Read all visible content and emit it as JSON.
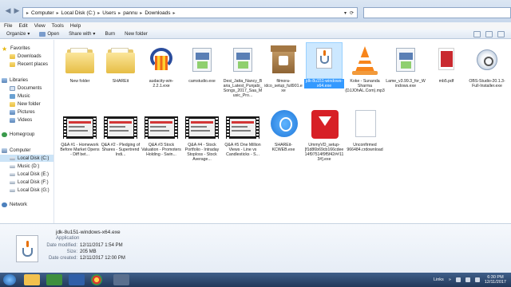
{
  "address": {
    "crumbs": [
      "Computer",
      "Local Disk (C:)",
      "Users",
      "pannu",
      "Downloads"
    ]
  },
  "menu": [
    "File",
    "Edit",
    "View",
    "Tools",
    "Help"
  ],
  "toolbar": {
    "organize": "Organize",
    "open": "Open",
    "share_with": "Share with",
    "burn": "Burn",
    "new_folder": "New folder"
  },
  "nav": {
    "favorites": "Favorites",
    "downloads": "Downloads",
    "recent": "Recent places",
    "libraries": "Libraries",
    "documents": "Documents",
    "music": "Music",
    "new_folder": "New folder",
    "pictures": "Pictures",
    "videos": "Videos",
    "homegroup": "Homegroup",
    "computer": "Computer",
    "local_c": "Local Disk (C:)",
    "music_d": "Music (D:)",
    "local_e": "Local Disk (E:)",
    "local_f": "Local Disk (F:)",
    "local_g": "Local Disk (G:)",
    "network": "Network"
  },
  "files": [
    {
      "label": "New folder",
      "icon": "folder-icon"
    },
    {
      "label": "SHAREit",
      "icon": "folder-icon"
    },
    {
      "label": "audacity-win-2.2.1.exe",
      "icon": "audacity-icon"
    },
    {
      "label": "camstudio.exe",
      "icon": "installer-icon"
    },
    {
      "label": "Desi_Jatta_Nancy_Baria_Latest_Punjabi_Songs_2017_Saa_Music_Pro...",
      "icon": "installer-icon"
    },
    {
      "label": "filmora-idco_setup_full901.exe",
      "icon": "filmora-box-icon"
    },
    {
      "label": "jdk-8u151-windows-x64.exe",
      "icon": "java-icon"
    },
    {
      "label": "Koke - Sunanda Sharma (DJJOhAL.Com).mp3",
      "icon": "vlc-cone-icon"
    },
    {
      "label": "Lame_v3.99.3_for_Windows.exe",
      "icon": "installer-icon"
    },
    {
      "label": "mb5.pdf",
      "icon": "pdf-icon"
    },
    {
      "label": "OBS-Studio-20.1.3-Full-Installer.exe",
      "icon": "obs-icon"
    },
    {
      "label": "Q&A #1 - Homework Before Market Opens - Diff bet...",
      "icon": "video-thumbnail-icon"
    },
    {
      "label": "Q&A #2 - Pledging of Shares - Supertrend Indi...",
      "icon": "video-thumbnail-icon"
    },
    {
      "label": "Q&A #3 Stock Valuation - Promoters Holding - Swin...",
      "icon": "video-thumbnail-icon"
    },
    {
      "label": "Q&A #4 - Stock Portfolio - Intraday Stoploss - Stock Average...",
      "icon": "video-thumbnail-icon"
    },
    {
      "label": "Q&A #5 One Million Views - Line vs Candlesticks - S...",
      "icon": "video-thumbnail-icon"
    },
    {
      "label": "SHAREit-KCWEB.exe",
      "icon": "shareit-icon"
    },
    {
      "label": "UmmyVD_setup-[f1d86b69cb166cdee14f97514f9f5f42##113#].exe",
      "icon": "ummy-download-icon"
    },
    {
      "label": "Unconfirmed 966484.crdownload",
      "icon": "blank-file-icon"
    }
  ],
  "details": {
    "name": "jdk-8u151-windows-x64.exe",
    "type": "Application",
    "modified_key": "Date modified:",
    "modified_val": "12/11/2017 1:54 PM",
    "size_key": "Size:",
    "size_val": "205 MB",
    "created_key": "Date created:",
    "created_val": "12/11/2017 12:00 PM"
  },
  "taskbar": {
    "links": "Links",
    "time": "6:30 PM",
    "date": "12/11/2017"
  }
}
